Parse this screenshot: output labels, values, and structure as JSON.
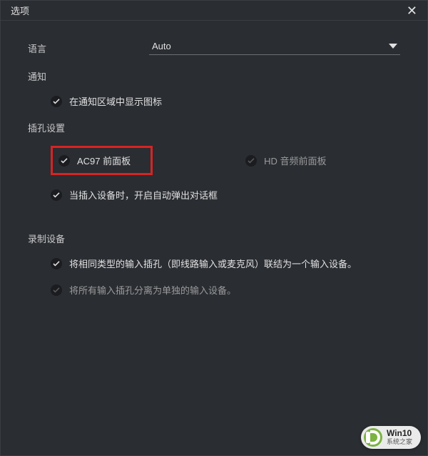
{
  "titlebar": {
    "title": "选项"
  },
  "language": {
    "label": "语言",
    "value": "Auto"
  },
  "notification": {
    "label": "通知",
    "show_tray_icon": "在通知区域中显示图标"
  },
  "jack": {
    "label": "插孔设置",
    "ac97": "AC97 前面板",
    "hd": "HD 音频前面板",
    "auto_popup": "当插入设备时，开启自动弹出对话框"
  },
  "recording": {
    "label": "录制设备",
    "combine": "将相同类型的输入插孔（即线路输入或麦克风）联结为一个输入设备。",
    "separate": "将所有输入插孔分离为单独的输入设备。"
  },
  "watermark": {
    "line1": "Win10",
    "line2": "系统之家"
  }
}
